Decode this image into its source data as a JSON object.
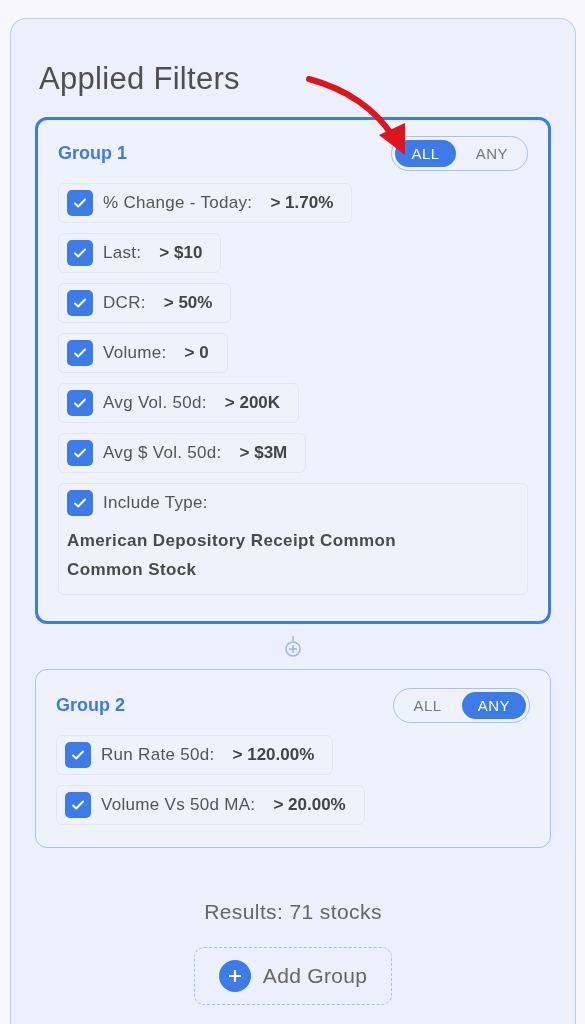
{
  "title": "Applied Filters",
  "groups": [
    {
      "name": "Group 1",
      "highlighted": true,
      "match_options": [
        {
          "label": "ALL",
          "selected": true
        },
        {
          "label": "ANY",
          "selected": false
        }
      ],
      "filters": [
        {
          "kind": "condition",
          "label": "% Change - Today:",
          "value": "> 1.70%",
          "checked": true
        },
        {
          "kind": "condition",
          "label": "Last:",
          "value": "> $10",
          "checked": true
        },
        {
          "kind": "condition",
          "label": "DCR:",
          "value": "> 50%",
          "checked": true
        },
        {
          "kind": "condition",
          "label": "Volume:",
          "value": "> 0",
          "checked": true
        },
        {
          "kind": "condition",
          "label": "Avg Vol. 50d:",
          "value": "> 200K",
          "checked": true
        },
        {
          "kind": "condition",
          "label": "Avg $ Vol. 50d:",
          "value": "> $3M",
          "checked": true
        },
        {
          "kind": "type",
          "label": "Include Type:",
          "value": "American Depository Receipt Common Common Stock",
          "checked": true
        }
      ]
    },
    {
      "name": "Group 2",
      "highlighted": false,
      "match_options": [
        {
          "label": "ALL",
          "selected": false
        },
        {
          "label": "ANY",
          "selected": true
        }
      ],
      "filters": [
        {
          "kind": "condition",
          "label": "Run Rate 50d:",
          "value": "> 120.00%",
          "checked": true
        },
        {
          "kind": "condition",
          "label": "Volume Vs 50d MA:",
          "value": "> 20.00%",
          "checked": true
        }
      ]
    }
  ],
  "results": "Results: 71 stocks",
  "add_button": "Add Group"
}
